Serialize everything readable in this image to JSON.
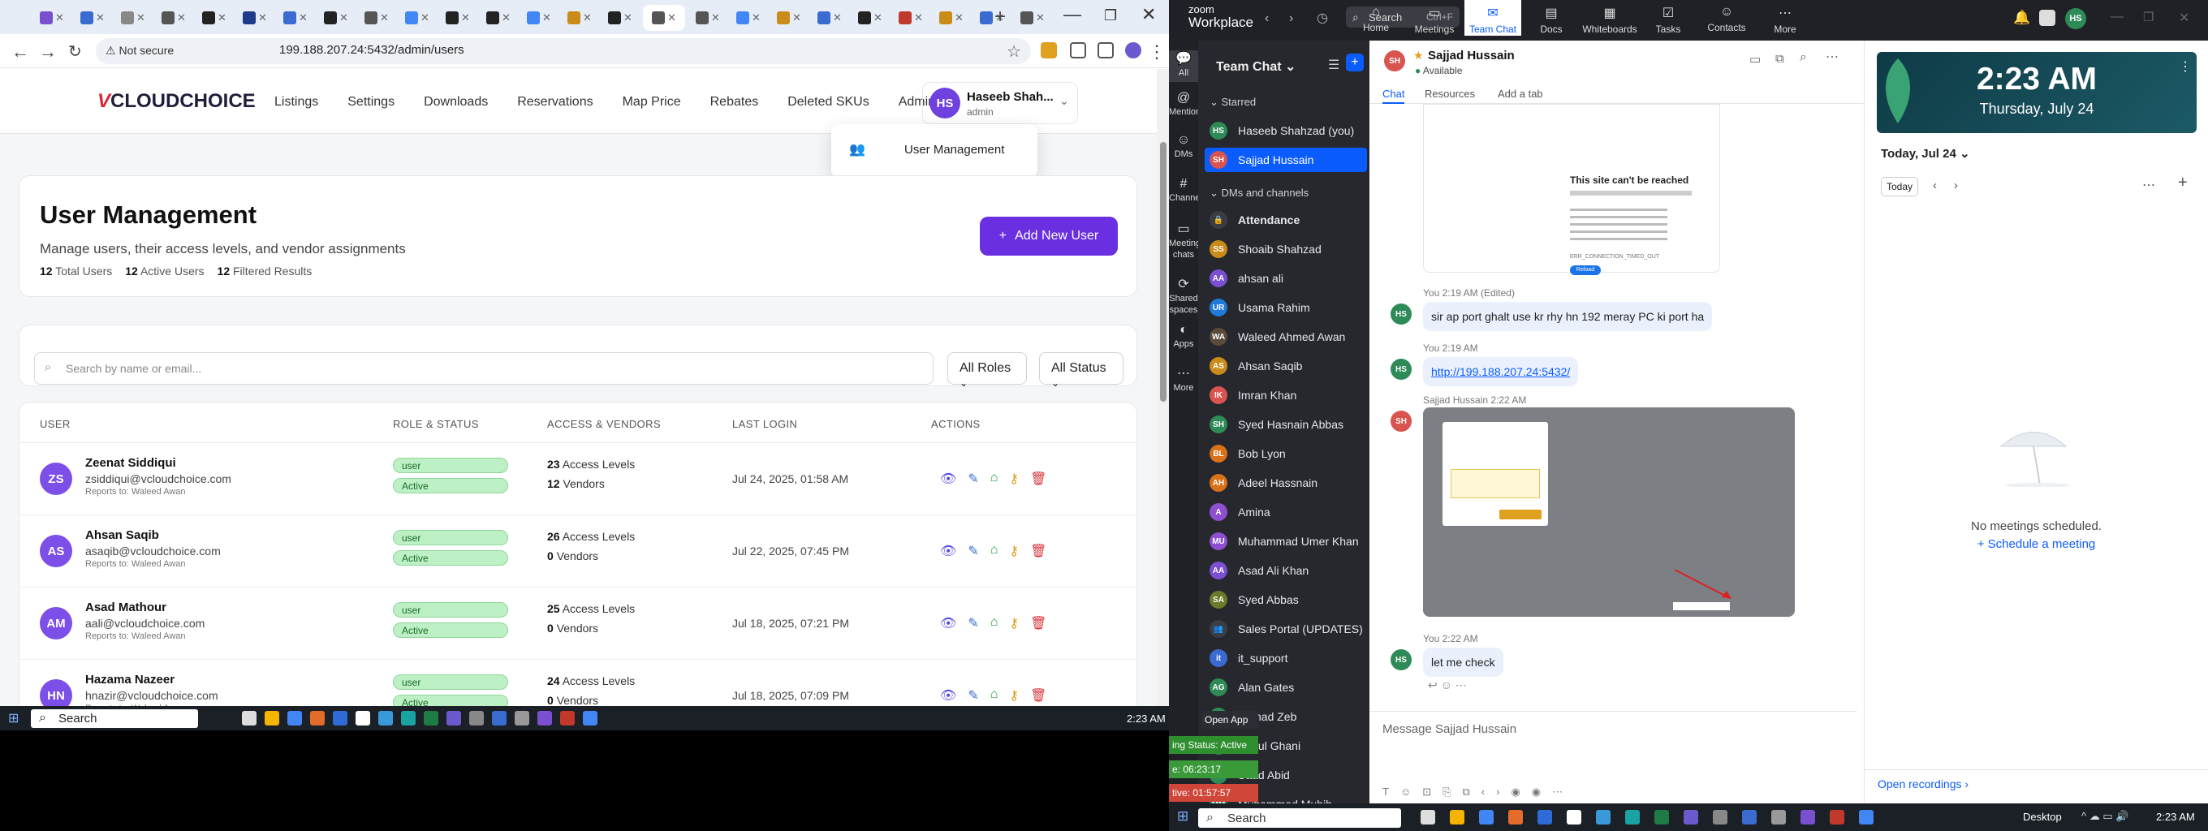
{
  "browser": {
    "url_security": "Not secure",
    "url": "199.188.207.24:5432/admin/users"
  },
  "app": {
    "brand": "CLOUDCHOICE",
    "brand_v": "V",
    "nav": [
      "Listings",
      "Settings",
      "Downloads",
      "Reservations",
      "Map Price",
      "Rebates",
      "Deleted SKUs",
      "Admin"
    ],
    "user_initials": "HS",
    "user_name": "Haseeb Shah...",
    "user_role": "admin",
    "dropdown_item": "User Management"
  },
  "page": {
    "title": "User Management",
    "subtitle": "Manage users, their access levels, and vendor assignments",
    "stats": [
      {
        "count": "12",
        "label": "Total Users"
      },
      {
        "count": "12",
        "label": "Active Users"
      },
      {
        "count": "12",
        "label": "Filtered Results"
      }
    ],
    "add_button": "Add New User",
    "search_placeholder": "Search by name or email...",
    "role_filter": "All Roles",
    "status_filter": "All Status"
  },
  "table": {
    "headers": [
      "USER",
      "ROLE & STATUS",
      "ACCESS & VENDORS",
      "LAST LOGIN",
      "ACTIONS"
    ],
    "rows": [
      {
        "initials": "ZS",
        "name": "Zeenat Siddiqui",
        "email": "zsiddiqui@vcloudchoice.com",
        "reports": "Reports to: Waleed Awan",
        "role": "user",
        "status": "Active",
        "access": "23",
        "access_label": "Access Levels",
        "vendors": "12",
        "vendors_label": "Vendors",
        "last_login": "Jul 24, 2025, 01:58 AM"
      },
      {
        "initials": "AS",
        "name": "Ahsan Saqib",
        "email": "asaqib@vcloudchoice.com",
        "reports": "Reports to: Waleed Awan",
        "role": "user",
        "status": "Active",
        "access": "26",
        "access_label": "Access Levels",
        "vendors": "0",
        "vendors_label": "Vendors",
        "last_login": "Jul 22, 2025, 07:45 PM"
      },
      {
        "initials": "AM",
        "name": "Asad Mathour",
        "email": "aali@vcloudchoice.com",
        "reports": "Reports to: Waleed Awan",
        "role": "user",
        "status": "Active",
        "access": "25",
        "access_label": "Access Levels",
        "vendors": "0",
        "vendors_label": "Vendors",
        "last_login": "Jul 18, 2025, 07:21 PM"
      },
      {
        "initials": "HN",
        "name": "Hazama Nazeer",
        "email": "hnazir@vcloudchoice.com",
        "reports": "Reports to: Waleed Awan",
        "role": "user",
        "status": "Active",
        "access": "24",
        "access_label": "Access Levels",
        "vendors": "0",
        "vendors_label": "Vendors",
        "last_login": "Jul 18, 2025, 07:09 PM"
      }
    ]
  },
  "taskbar_left": {
    "search": "Search",
    "time": "2:23 AM"
  },
  "zoom": {
    "logo_top": "zoom",
    "logo_bottom": "Workplace",
    "search": "Search",
    "search_key": "Ctrl+F",
    "top_tabs": [
      "Home",
      "Meetings",
      "Team Chat",
      "Docs",
      "Whiteboards",
      "Tasks",
      "Contacts",
      "More"
    ],
    "rail": [
      "All",
      "Mentions",
      "DMs",
      "Channels",
      "Meeting chats",
      "Shared spaces",
      "Apps",
      "More"
    ],
    "list_title": "Team Chat",
    "starred_label": "Starred",
    "starred": [
      {
        "initials": "HS",
        "name": "Haseeb Shahzad (you)",
        "color": "#2e8b57"
      },
      {
        "initials": "SH",
        "name": "Sajjad Hussain",
        "color": "#d9534f"
      }
    ],
    "dms_label": "DMs and channels",
    "contacts": [
      {
        "initials": "🔒",
        "name": "Attendance",
        "color": "#3a3d44"
      },
      {
        "initials": "SS",
        "name": "Shoaib Shahzad",
        "color": "#c98b1a"
      },
      {
        "initials": "AA",
        "name": "ahsan ali",
        "color": "#7a4fd0"
      },
      {
        "initials": "UR",
        "name": "Usama Rahim",
        "color": "#1e7bd9"
      },
      {
        "initials": "WA",
        "name": "Waleed Ahmed Awan",
        "color": "#5b4a3a"
      },
      {
        "initials": "AS",
        "name": "Ahsan Saqib",
        "color": "#c98b1a"
      },
      {
        "initials": "IK",
        "name": "Imran Khan",
        "color": "#d9534f"
      },
      {
        "initials": "SH",
        "name": "Syed Hasnain Abbas",
        "color": "#2e8b57"
      },
      {
        "initials": "BL",
        "name": "Bob Lyon",
        "color": "#d9711a"
      },
      {
        "initials": "AH",
        "name": "Adeel Hassnain",
        "color": "#d9711a"
      },
      {
        "initials": "A",
        "name": "Amina",
        "color": "#8e4fd0"
      },
      {
        "initials": "MU",
        "name": "Muhammad Umer Khan",
        "color": "#8e4fd0"
      },
      {
        "initials": "AA",
        "name": "Asad Ali Khan",
        "color": "#7a4fd0"
      },
      {
        "initials": "SA",
        "name": "Syed Abbas",
        "color": "#6b7a2a"
      },
      {
        "initials": "👥",
        "name": "Sales Portal (UPDATES)",
        "color": "#3a3d44"
      },
      {
        "initials": "it",
        "name": "it_support",
        "color": "#3a6bd0"
      },
      {
        "initials": "AG",
        "name": "Alan Gates",
        "color": "#2e8b57"
      },
      {
        "initials": "AZ",
        "name": "Ahmad Zeb",
        "color": "#2e8b57"
      },
      {
        "initials": "AG",
        "name": "Abdul Ghani",
        "color": "#2e8b57"
      },
      {
        "initials": "SA",
        "name": "Saad Abid",
        "color": "#2e8b57"
      },
      {
        "initials": "MM",
        "name": "Muhammad Muhib",
        "color": "#2e8b57"
      }
    ],
    "chat": {
      "initials": "SH",
      "name": "Sajjad Hussain",
      "presence": "Available",
      "tabs": [
        "Chat",
        "Resources",
        "Add a tab"
      ],
      "screenshot_title": "This site can't be reached",
      "screenshot_error": "ERR_CONNECTION_TIMED_OUT",
      "screenshot_button": "Reload",
      "messages": [
        {
          "meta": "You 2:19 AM (Edited)",
          "text": "sir ap port ghalt use kr rhy hn 192 meray PC ki port ha",
          "initials": "HS"
        },
        {
          "meta": "You 2:19 AM",
          "text": "http://199.188.207.24:5432/",
          "initials": "HS"
        },
        {
          "meta": "Sajjad Hussain 2:22 AM",
          "text": "",
          "initials": "SH"
        },
        {
          "meta": "You 2:22 AM",
          "text": "let me check",
          "initials": "HS"
        }
      ],
      "input_placeholder": "Message Sajjad Hussain"
    },
    "calendar": {
      "time": "2:23 AM",
      "date": "Thursday, July 24",
      "today_label": "Today, Jul 24",
      "today_button": "Today",
      "empty": "No meetings scheduled.",
      "schedule": "Schedule a meeting",
      "recordings": "Open recordings"
    }
  },
  "overlays": {
    "open_app": "Open App",
    "status": "ing Status: Active",
    "timer1": "e: 06:23:17",
    "timer2": "tive: 01:57:57"
  },
  "taskbar_right": {
    "search": "Search",
    "desktop": "Desktop",
    "time": "2:23 AM"
  }
}
